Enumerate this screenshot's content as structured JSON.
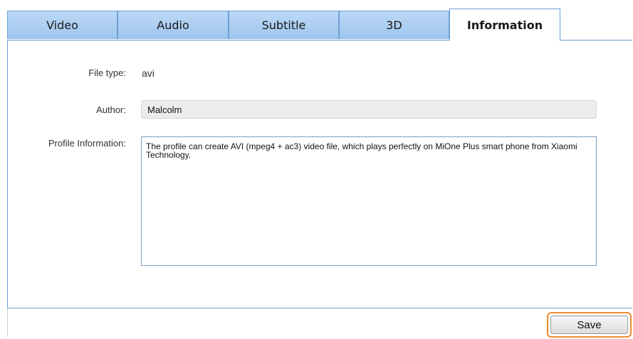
{
  "tabs": [
    {
      "label": "Video"
    },
    {
      "label": "Audio"
    },
    {
      "label": "Subtitle"
    },
    {
      "label": "3D"
    },
    {
      "label": "Information",
      "active": true
    }
  ],
  "form": {
    "file_type_label": "File type:",
    "file_type_value": "avi",
    "author_label": "Author:",
    "author_value": "Malcolm",
    "profile_label": "Profile Information:",
    "profile_value": "The profile can create AVI (mpeg4 + ac3) video file, which plays perfectly on MiOne Plus smart phone from Xiaomi Technology."
  },
  "footer": {
    "save_label": "Save"
  },
  "colors": {
    "tab_gradient_top": "#bcd9f5",
    "tab_gradient_bottom": "#9fc5ee",
    "border_blue": "#6d9fd6",
    "save_highlight": "#f08a30"
  }
}
